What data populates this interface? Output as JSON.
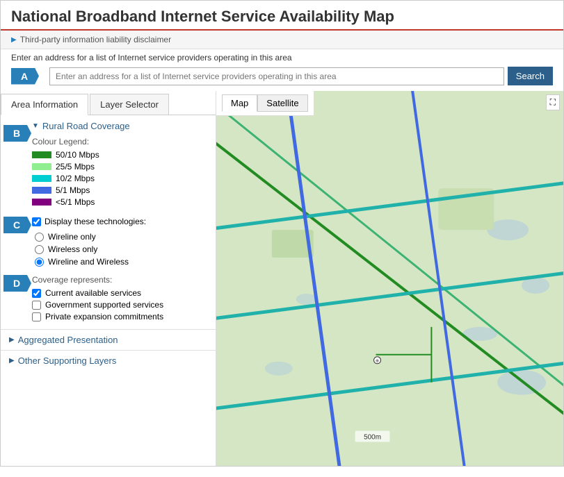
{
  "header": {
    "title": "National Broadband Internet Service Availability Map"
  },
  "disclaimer": {
    "icon": "▶",
    "text": "Third-party information liability disclaimer"
  },
  "search": {
    "label": "Enter an address for a list of Internet service providers operating in this area",
    "placeholder": "Enter an address for a list of Internet service providers operating in this area",
    "button_label": "Search"
  },
  "arrows": {
    "a": "A",
    "b": "B",
    "c": "C",
    "d": "D"
  },
  "tabs": {
    "area_info": "Area Information",
    "layer_selector": "Layer Selector"
  },
  "layer_selector": {
    "section_title": "Rural Road Coverage",
    "colour_legend_title": "Colour Legend:",
    "legend_items": [
      {
        "color": "#228B22",
        "label": "50/10 Mbps"
      },
      {
        "color": "#90EE90",
        "label": "25/5 Mbps"
      },
      {
        "color": "#00CED1",
        "label": "10/2 Mbps"
      },
      {
        "color": "#4169E1",
        "label": "5/1 Mbps"
      },
      {
        "color": "#800080",
        "label": "<5/1 Mbps"
      }
    ],
    "display_tech_label": "Display these technologies:",
    "display_tech_checked": true,
    "radio_options": [
      {
        "label": "Wireline only",
        "checked": false
      },
      {
        "label": "Wireless only",
        "checked": false
      },
      {
        "label": "Wireline and Wireless",
        "checked": true
      }
    ],
    "coverage_represents_title": "Coverage represents:",
    "coverage_items": [
      {
        "label": "Current available services",
        "checked": true
      },
      {
        "label": "Government supported services",
        "checked": false
      },
      {
        "label": "Private expansion commitments",
        "checked": false
      }
    ],
    "aggregated_label": "Aggregated Presentation",
    "other_layers_label": "Other Supporting Layers"
  },
  "map": {
    "tab_map": "Map",
    "tab_satellite": "Satellite",
    "fullscreen_icon": "⛶",
    "zoom_label": "500m"
  }
}
